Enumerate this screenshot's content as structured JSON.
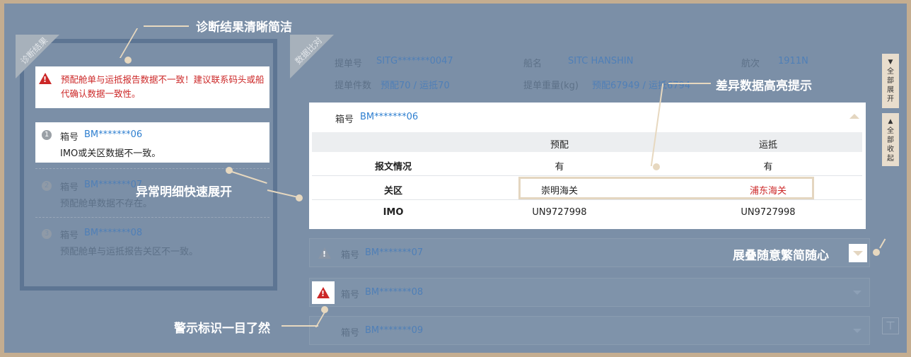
{
  "callouts": {
    "top": "诊断结果清晰简洁",
    "left": "异常明细快速展开",
    "bottom": "警示标识一目了然",
    "diff": "差异数据高亮提示",
    "right": "展叠随意繁简随心"
  },
  "left_panel": {
    "ribbon": "诊断结果",
    "alert": "预配舱单与运抵报告数据不一致！建议联系码头或船代确认数据一致性。",
    "items": [
      {
        "num": "1",
        "label": "箱号",
        "value": "BM*******06",
        "desc": "IMO或关区数据不一致。"
      },
      {
        "num": "2",
        "label": "箱号",
        "value": "BM*******07",
        "desc": "预配舱单数据不存在。"
      },
      {
        "num": "3",
        "label": "箱号",
        "value": "BM*******08",
        "desc": "预配舱单与运抵报告关区不一致。"
      }
    ]
  },
  "right_panel": {
    "ribbon": "数据比对",
    "header": {
      "bl_label": "提单号",
      "bl_value": "SITG*******0047",
      "ship_label": "船名",
      "ship_value": "SITC HANSHIN",
      "voyage_label": "航次",
      "voyage_value": "1911N",
      "pieces_label": "提单件数",
      "pieces_value": "预配70 / 运抵70",
      "weight_label": "提单重量(kg)",
      "weight_value": "预配67949 / 运抵6794"
    },
    "expanded": {
      "label": "箱号",
      "value": "BM*******06",
      "columns": [
        "",
        "预配",
        "运抵"
      ],
      "rows": [
        {
          "field": "报文情况",
          "a": "有",
          "b": "有"
        },
        {
          "field": "关区",
          "a": "崇明海关",
          "b": "浦东海关"
        },
        {
          "field": "IMO",
          "a": "UN9727998",
          "b": "UN9727998"
        }
      ]
    },
    "collapsed": [
      {
        "label": "箱号",
        "value": "BM*******07"
      },
      {
        "label": "箱号",
        "value": "BM*******08"
      },
      {
        "label": "箱号",
        "value": "BM*******09"
      }
    ]
  },
  "side_buttons": {
    "expand_all": "全部展开",
    "collapse_all": "全部收起"
  },
  "colors": {
    "alert_red": "#cc2727",
    "link_blue": "#2e7fd0",
    "panel_bg": "#7b8fa7",
    "frame": "#c4ad90"
  }
}
